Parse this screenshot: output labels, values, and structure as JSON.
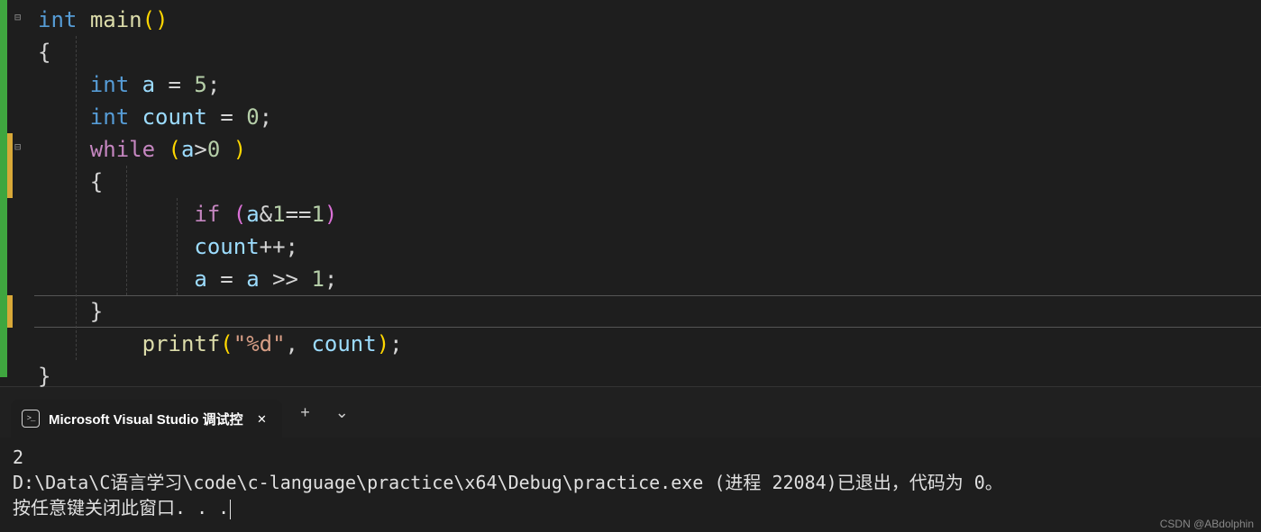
{
  "code": {
    "line1": {
      "kw_int": "int",
      "fn_main": "main",
      "paren_open": "(",
      "paren_close": ")"
    },
    "line2": {
      "brace": "{"
    },
    "line3": {
      "kw_int": "int",
      "var_a": "a",
      "eq": "=",
      "num": "5",
      "semi": ";"
    },
    "line4": {
      "kw_int": "int",
      "var_count": "count",
      "eq": "=",
      "num": "0",
      "semi": ";"
    },
    "line5": {
      "kw_while": "while",
      "paren_open": "(",
      "var_a": "a",
      "op_gt": ">",
      "num": "0",
      "paren_close": ")"
    },
    "line6": {
      "brace": "{"
    },
    "line7": {
      "kw_if": "if",
      "paren_open": "(",
      "var_a": "a",
      "op_and": "&",
      "num_1": "1",
      "op_eq": "==",
      "num_1b": "1",
      "paren_close": ")"
    },
    "line8": {
      "var_count": "count",
      "op_inc": "++",
      "semi": ";"
    },
    "line9": {
      "var_a": "a",
      "eq": "=",
      "var_a2": "a",
      "op_shr": ">>",
      "num": "1",
      "semi": ";"
    },
    "line10": {
      "brace": "}"
    },
    "line11": {
      "fn_printf": "printf",
      "paren_open": "(",
      "str": "\"%d\"",
      "comma": ",",
      "var_count": "count",
      "paren_close": ")",
      "semi": ";"
    },
    "line12": {
      "brace": "}"
    }
  },
  "terminal": {
    "tab_title": "Microsoft Visual Studio 调试控",
    "output_line1": "2",
    "output_line2": "D:\\Data\\C语言学习\\code\\c-language\\practice\\x64\\Debug\\practice.exe (进程 22084)已退出，代码为 0。",
    "output_line3": "按任意键关闭此窗口. . ."
  },
  "watermark": "CSDN @ABdolphin",
  "icons": {
    "add_tab": "+",
    "dropdown": "⌄",
    "close": "✕",
    "fold_minus": "⊟"
  }
}
